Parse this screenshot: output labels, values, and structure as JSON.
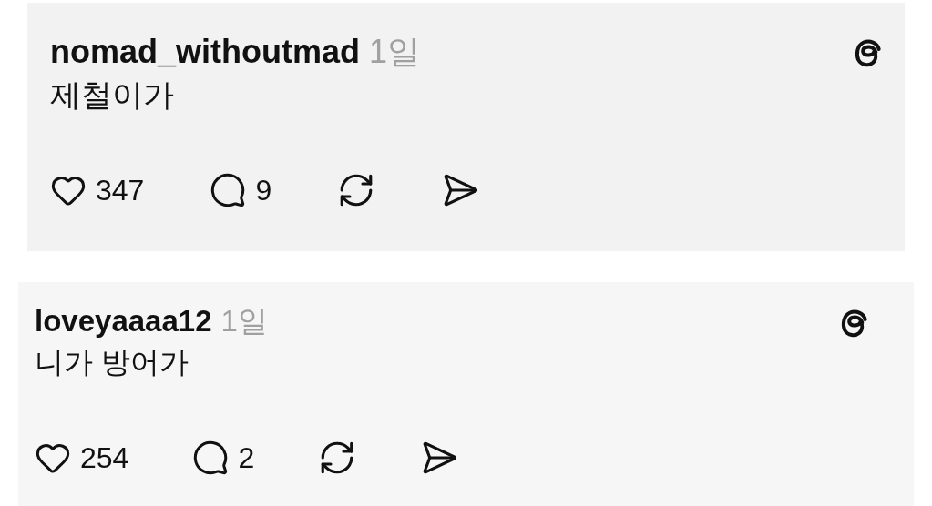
{
  "posts": [
    {
      "username": "nomad_withoutmad",
      "time": "1일",
      "text": "제철이가",
      "likes": "347",
      "replies": "9"
    },
    {
      "username": "loveyaaaa12",
      "time": "1일",
      "text": "니가 방어가",
      "likes": "254",
      "replies": "2"
    }
  ]
}
